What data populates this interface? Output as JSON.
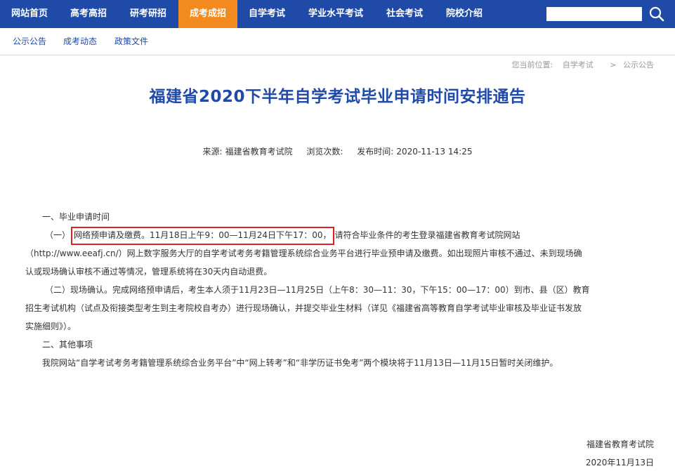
{
  "nav": {
    "items": [
      {
        "label": "网站首页"
      },
      {
        "label": "高考高招"
      },
      {
        "label": "研考研招"
      },
      {
        "label": "成考成招"
      },
      {
        "label": "自学考试"
      },
      {
        "label": "学业水平考试"
      },
      {
        "label": "社会考试"
      },
      {
        "label": "院校介绍"
      }
    ],
    "active_index": 3,
    "search_value": "",
    "search_icon": "search-icon"
  },
  "subnav": {
    "items": [
      {
        "label": "公示公告"
      },
      {
        "label": "成考动态"
      },
      {
        "label": "政策文件"
      }
    ]
  },
  "breadcrumb": {
    "prefix": "您当前位置:",
    "level1": "自学考试",
    "separator": ">",
    "level2": "公示公告"
  },
  "article": {
    "title": "福建省2020下半年自学考试毕业申请时间安排通告",
    "meta": {
      "source_label": "来源:",
      "source_value": "福建省教育考试院",
      "views_label": "浏览次数:",
      "published_label": "发布时间:",
      "published_value": "2020-11-13 14:25"
    },
    "section1_heading": "一、毕业申请时间",
    "item1_prefix": "（一）",
    "item1_highlight": "网络预申请及缴费。11月18日上午9：00—11月24日下午17：00，",
    "item1_rest": "请符合毕业条件的考生登录福建省教育考试院网站",
    "item1_line2": "（http://www.eeafj.cn/）网上数字服务大厅的自学考试考务考籍管理系统综合业务平台进行毕业预申请及缴费。如出现照片审核不通过、未到现场确",
    "item1_line3": "认或现场确认审核不通过等情况，管理系统将在30天内自动退费。",
    "item2_line1": "（二）现场确认。完成网络预申请后，考生本人须于11月23日—11月25日（上午8：30—11：30，下午15：00—17：00）到市、县（区）教育",
    "item2_line2": "招生考试机构（试点及衔接类型考生到主考院校自考办）进行现场确认，并提交毕业生材料（详见《福建省高等教育自学考试毕业审核及毕业证书发放",
    "item2_line3": "实施细则》）。",
    "section2_heading": "二、其他事项",
    "section2_text": "我院网站“自学考试考务考籍管理系统综合业务平台”中“网上转考”和“非学历证书免考”两个模块将于11月13日—11月15日暂时关闭维护。",
    "signature_org": "福建省教育考试院",
    "signature_date": "2020年11月13日"
  },
  "colors": {
    "nav_bg": "#1f4aa8",
    "nav_active": "#f28a20",
    "title": "#1f4aa8",
    "highlight_border": "#e02020"
  }
}
